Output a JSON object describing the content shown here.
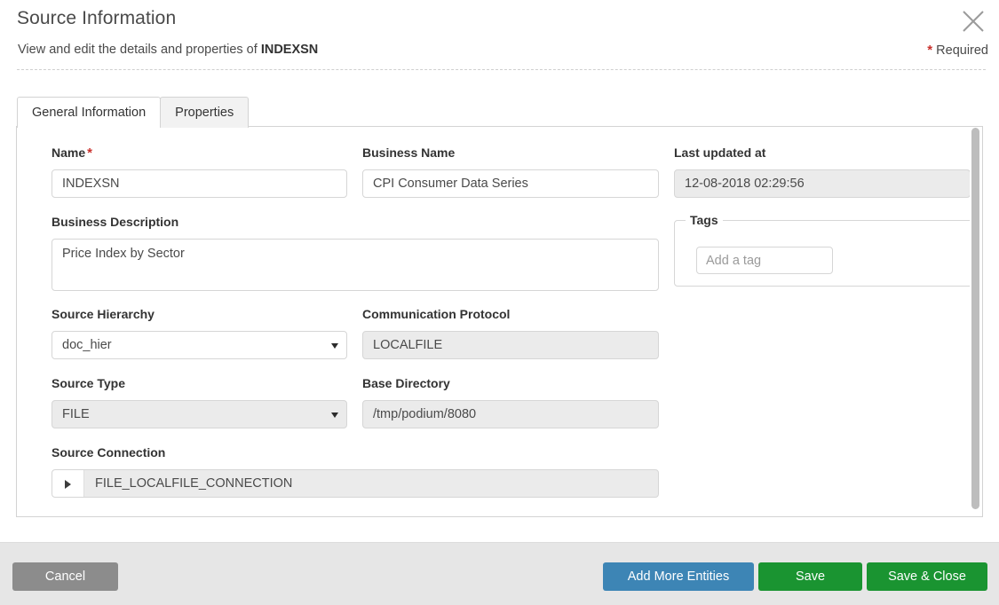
{
  "header": {
    "title": "Source Information",
    "subtitle_prefix": "View and edit the details and properties of ",
    "subtitle_entity": "INDEXSN",
    "required_star": "*",
    "required_label": "Required",
    "close_icon": "close-icon"
  },
  "tabs": [
    {
      "label": "General Information",
      "active": true
    },
    {
      "label": "Properties",
      "active": false
    }
  ],
  "form": {
    "name": {
      "label": "Name",
      "required_star": "*",
      "value": "INDEXSN",
      "placeholder": ""
    },
    "business_name": {
      "label": "Business Name",
      "value": "CPI Consumer Data Series",
      "placeholder": ""
    },
    "last_updated_at": {
      "label": "Last updated at",
      "value": "12-08-2018 02:29:56"
    },
    "business_description": {
      "label": "Business Description",
      "value": "Price Index by Sector",
      "placeholder": ""
    },
    "tags": {
      "legend": "Tags",
      "input_placeholder": "Add a tag",
      "input_value": ""
    },
    "source_hierarchy": {
      "label": "Source Hierarchy",
      "value": "doc_hier",
      "caret_icon": "chevron-down-icon"
    },
    "communication_protocol": {
      "label": "Communication Protocol",
      "value": "LOCALFILE"
    },
    "source_type": {
      "label": "Source Type",
      "value": "FILE",
      "caret_icon": "chevron-down-icon"
    },
    "base_directory": {
      "label": "Base Directory",
      "value": "/tmp/podium/8080"
    },
    "source_connection": {
      "label": "Source Connection",
      "value": "FILE_LOCALFILE_CONNECTION",
      "expand_icon": "triangle-right-icon"
    }
  },
  "footer": {
    "cancel_label": "Cancel",
    "add_more_entities_label": "Add More Entities",
    "save_label": "Save",
    "save_close_label": "Save & Close"
  },
  "colors": {
    "primary_blue": "#3d85b5",
    "success_green": "#1a9431",
    "neutral_gray": "#8c8c8c",
    "required_red": "#c9302c",
    "readonly_bg": "#ebebeb"
  }
}
